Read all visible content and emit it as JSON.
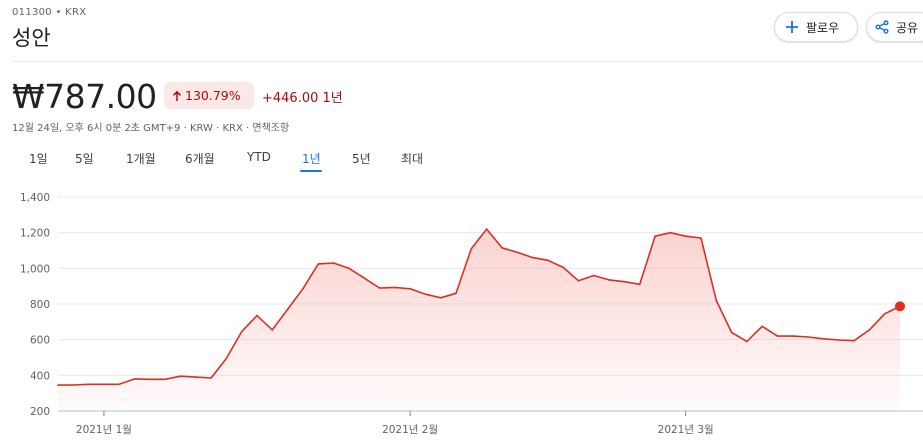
{
  "header": {
    "ticker": "011300 • KRX",
    "name": "성안",
    "follow_label": "팔로우",
    "share_label": "공유"
  },
  "quote": {
    "price": "₩787.00",
    "change_percent": "130.79%",
    "change_abs": "+446.00 1년",
    "meta": "12월 24일, 오후 6시 0분 2초 GMT+9 · KRW · KRX · 면책조항"
  },
  "tabs": [
    "1일",
    "5일",
    "1개월",
    "6개월",
    "YTD",
    "1년",
    "5년",
    "최대"
  ],
  "active_tab": "1년",
  "colors": {
    "negative_accent": "#d93025",
    "positive_chip_bg": "#fce8e6",
    "tab_active": "#1a73e8"
  },
  "chart_data": {
    "type": "area",
    "ylim": [
      200,
      1400
    ],
    "y_ticks": [
      200,
      400,
      600,
      800,
      1000,
      1200,
      1400
    ],
    "y_tick_labels": [
      "200",
      "400",
      "600",
      "800",
      "1,000",
      "1,200",
      "1,400"
    ],
    "x_tick_labels": [
      "2021년 1월",
      "2021년 2월",
      "2021년 3월"
    ],
    "x_tick_index": [
      3,
      23,
      41
    ],
    "grid": true,
    "series": [
      {
        "values": [
          345,
          346,
          350,
          350,
          350,
          380,
          378,
          378,
          395,
          390,
          385,
          495,
          645,
          735,
          655,
          770,
          885,
          1025,
          1030,
          1000,
          945,
          890,
          893,
          885,
          855,
          835,
          860,
          1110,
          1220,
          1115,
          1090,
          1060,
          1045,
          1005,
          930,
          960,
          935,
          925,
          910,
          1180,
          1200,
          1180,
          1170,
          820,
          640,
          590,
          675,
          620,
          620,
          615,
          605,
          598,
          594,
          655,
          745,
          787
        ]
      }
    ]
  }
}
